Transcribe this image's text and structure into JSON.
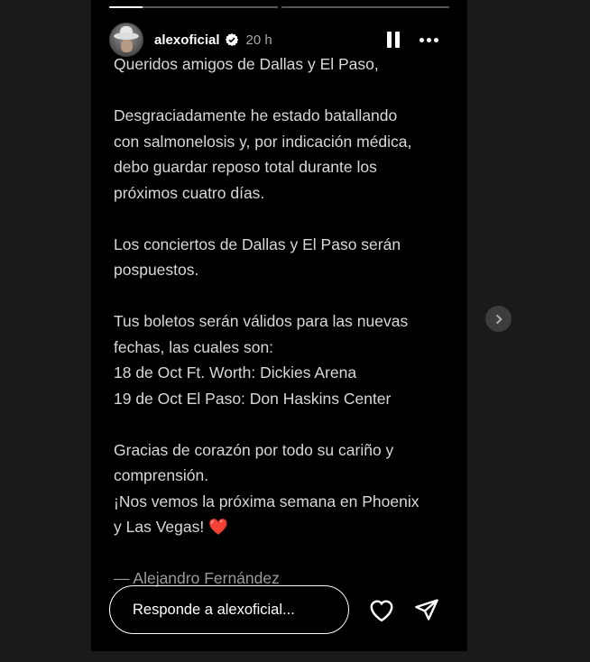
{
  "story": {
    "progress": [
      1,
      0
    ],
    "author": {
      "username": "alexoficial",
      "time": "20 h",
      "verified": true,
      "verified_color": "#ffffff"
    },
    "controls": {
      "pause_icon": "pause-icon",
      "more_icon": "more-icon"
    },
    "message": {
      "greeting": "Queridos amigos de Dallas y El Paso,",
      "p1_l1": "Desgraciadamente he estado batallando",
      "p1_l2": "con salmonelosis y, por indicación médica,",
      "p1_l3": "debo guardar reposo total durante los",
      "p1_l4": "próximos cuatro días.",
      "p2_l1": "Los conciertos de Dallas y El Paso serán",
      "p2_l2": "pospuestos.",
      "p3_l1": "Tus boletos serán válidos para las nuevas",
      "p3_l2": "fechas, las cuales son:",
      "p3_l3": "18 de Oct Ft. Worth: Dickies Arena",
      "p3_l4": "19 de Oct El Paso: Don Haskins Center",
      "p4_l1": "Gracias de corazón por todo su cariño y",
      "p4_l2": "comprensión.",
      "p4_l3": "¡Nos vemos la próxima semana en Phoenix",
      "p4_l4": "y Las Vegas! ",
      "heart": "❤️",
      "signature": "— Alejandro Fernández"
    },
    "reply": {
      "placeholder": "Responde a alexoficial..."
    },
    "accent": {
      "heart": "#e0303a",
      "background": "#000000",
      "page_bg": "#1a1a1a"
    }
  },
  "nav": {
    "next_icon": "chevron-right-icon"
  }
}
